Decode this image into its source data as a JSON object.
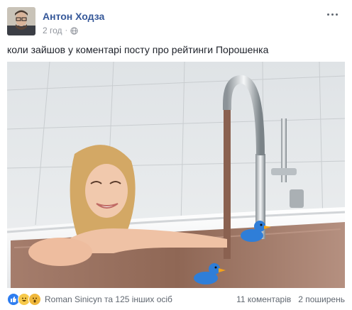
{
  "post": {
    "author": "Антон Ходза",
    "time": "2 год",
    "text": "коли зайшов у коментарі посту про рейтинги Порошенка"
  },
  "footer": {
    "reaction_icons": [
      "like-icon",
      "haha-icon",
      "wow-icon"
    ],
    "reaction_names": "Roman Sinicyn та 125 інших осіб",
    "comments": "11 коментарів",
    "shares": "2 поширень"
  },
  "colors": {
    "author_link": "#365899",
    "meta_text": "#90949c",
    "body_text": "#1d2129",
    "like": "#2f7ef0",
    "haha": "#f7c94b"
  }
}
